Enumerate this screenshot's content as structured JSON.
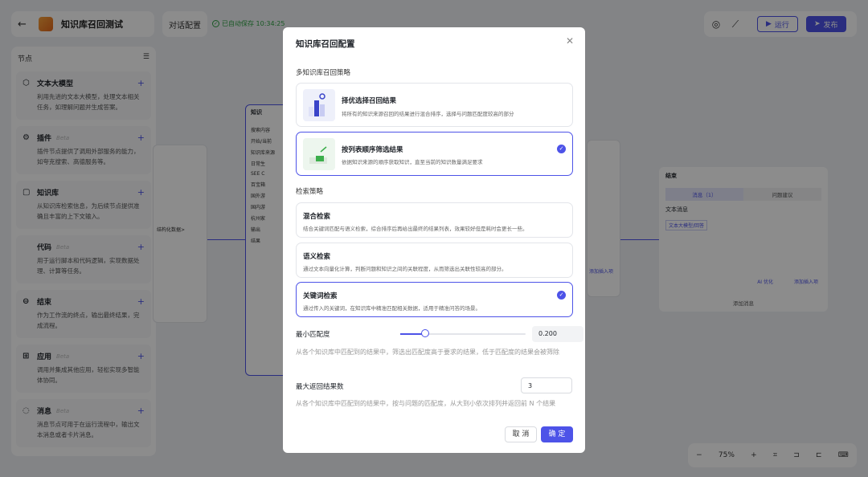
{
  "header": {
    "title": "知识库召回测试",
    "tab_chat": "对话配置",
    "saved_status": "已自动保存 10:34:25",
    "run_label": "运行",
    "publish_label": "发布"
  },
  "sidebar": {
    "title": "节点",
    "items": [
      {
        "icon": "model-icon",
        "title": "文本大模型",
        "beta": "",
        "desc": "利用先进的文本大模型，处理文本相关任务，如理解问题并生成答案。"
      },
      {
        "icon": "plugin-icon",
        "title": "插件",
        "beta": "Beta",
        "desc": "插件节点提供了调用外部服务的能力，如夸克搜索、高德服务等。"
      },
      {
        "icon": "knowledge-icon",
        "title": "知识库",
        "beta": "",
        "desc": "从知识库检索信息，为后续节点提供准确且丰富的上下文输入。"
      },
      {
        "icon": "code-icon",
        "title": "代码",
        "beta": "Beta",
        "desc": "用于运行脚本和代码逻辑，实现数据处理、计算等任务。"
      },
      {
        "icon": "end-icon",
        "title": "结束",
        "beta": "",
        "desc": "作为工作流的终点，输出最终结果，完成流程。"
      },
      {
        "icon": "app-icon",
        "title": "应用",
        "beta": "Beta",
        "desc": "调用并集成其他应用，轻松实现多智能体协同。"
      },
      {
        "icon": "message-icon",
        "title": "消息",
        "beta": "Beta",
        "desc": "消息节点可用于在运行流程中，输出文本消息或者卡片消息。"
      }
    ]
  },
  "canvas": {
    "knowledge_node_title": "知识",
    "knowledge_node_rows": [
      "搜索内容",
      "开始/当前",
      "知识库来源",
      "日常生",
      "SEE C",
      "百宝箱",
      "国外游",
      "国内游",
      "杭州家",
      "输出",
      "结果"
    ],
    "left_node_text": "结构化数据>",
    "end_node_title": "结束",
    "end_tab_1": "消息（1）",
    "end_tab_2": "问题建议",
    "end_section": "文本消息",
    "end_pill": "文本大模型/回答",
    "end_ai_opt": "AI 优化",
    "end_add_insert": "添加插入项",
    "end_add_msg": "添加消息",
    "mid_node_text": "添加插入项",
    "zoom": "75%"
  },
  "modal": {
    "title": "知识库召回配置",
    "multi_section": "多知识库召回策略",
    "multi_options": [
      {
        "title": "择优选择召回结果",
        "desc": "将所有的知识来源召回的结果进行混合排序，选择与问题匹配度较高的部分",
        "selected": false
      },
      {
        "title": "按列表顺序筛选结果",
        "desc": "依据知识来源的顺序获取知识，直至当前的知识数量满足要求",
        "selected": true
      }
    ],
    "retrieval_section": "检索策略",
    "retrieval_options": [
      {
        "title": "混合检索",
        "desc": "结合关键词匹配与语义检索，综合排序后再给出最终的结果列表，效果较好但是耗时会更长一些。",
        "selected": false
      },
      {
        "title": "语义检索",
        "desc": "通过文本向量化计算，判断问题和知识之间的关联程度，从而筛选出关联性较高的部分。",
        "selected": false
      },
      {
        "title": "关键词检索",
        "desc": "通过传入的关键词，在知识库中精准匹配相关数据，适用于精准问答的场景。",
        "selected": true
      }
    ],
    "min_match_label": "最小匹配度",
    "min_match_value": "0.200",
    "min_match_help": "从各个知识库中匹配到的结果中，筛选出匹配度高于要求的结果，低于匹配度的结果会被筛除",
    "max_results_label": "最大返回结果数",
    "max_results_value": "3",
    "max_results_help": "从各个知识库中匹配到的结果中，按与问题的匹配度，从大到小依次排列并返回前 N 个结果",
    "cancel_label": "取 消",
    "ok_label": "确 定"
  }
}
